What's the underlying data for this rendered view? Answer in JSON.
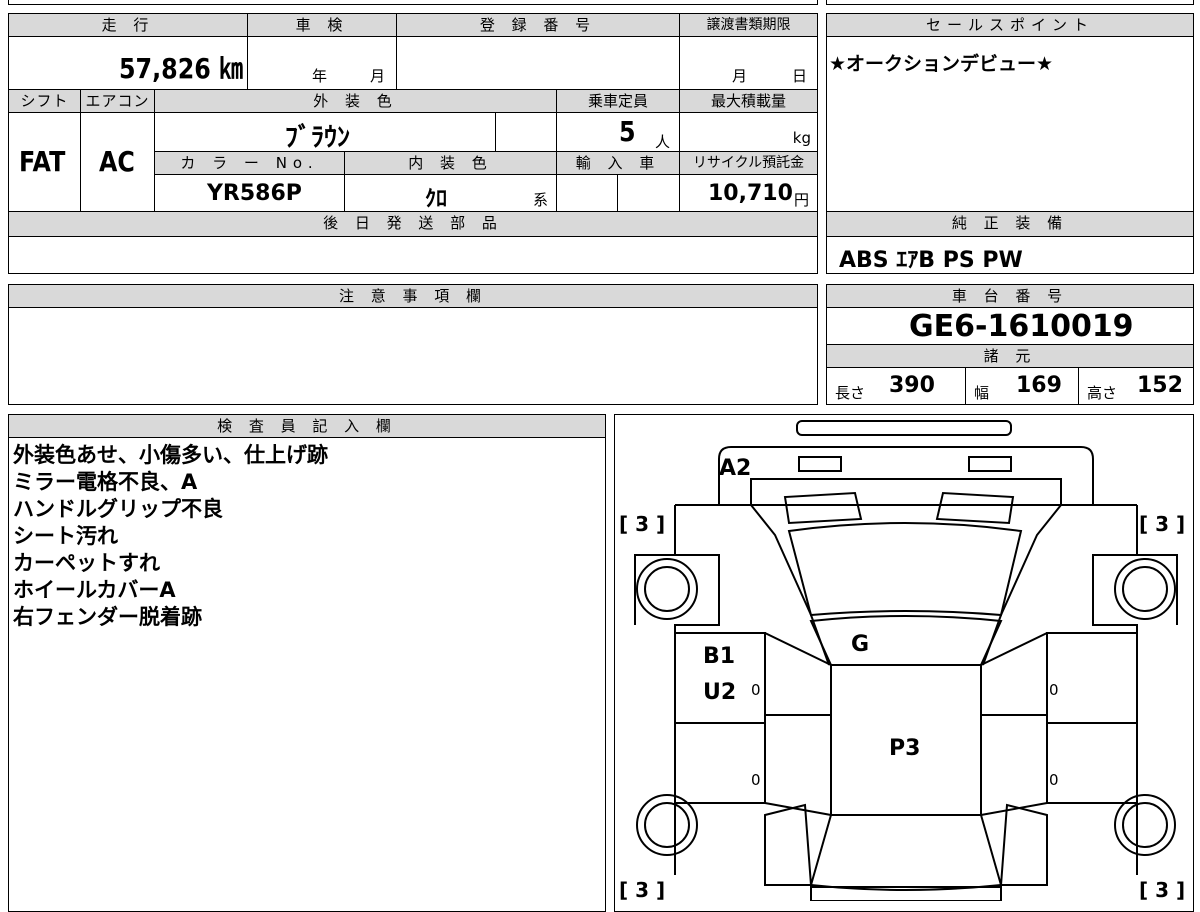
{
  "vehicle": {
    "mileage_label": "走 行",
    "mileage": "57,826 ㎞",
    "inspection_label": "車 検",
    "inspection_year_unit": "年",
    "inspection_month_unit": "月",
    "registration_label": "登 録 番 号",
    "registration_value": "",
    "transfer_deadline_label": "譲渡書類期限",
    "transfer_month_unit": "月",
    "transfer_day_unit": "日",
    "shift_label": "シフト",
    "shift": "FAT",
    "aircon_label": "エアコン",
    "aircon": "AC",
    "exterior_color_label": "外 装 色",
    "exterior_color": "ﾌﾞﾗｳﾝ",
    "capacity_label": "乗車定員",
    "capacity": "5",
    "capacity_unit": "人",
    "max_load_label": "最大積載量",
    "max_load_unit": "kg",
    "color_no_label": "カ ラ ー No.",
    "color_no": "YR586P",
    "interior_color_label": "内 装 色",
    "interior_color": "ｸﾛ",
    "interior_suffix": "系",
    "import_label": "輸 入 車",
    "recycle_label": "リサイクル預託金",
    "recycle_fee": "10,710",
    "recycle_unit": "円"
  },
  "sales_point": {
    "label": "セールスポイント",
    "text": "★オークションデビュー★"
  },
  "later_parts": {
    "label": "後 日 発 送 部 品"
  },
  "standard_equipment": {
    "label": "純 正 装 備",
    "items": "ABS ｴｱB PS PW"
  },
  "notes": {
    "label": "注 意 事 項 欄"
  },
  "chassis": {
    "label": "車 台 番 号",
    "number": "GE6-1610019"
  },
  "specs": {
    "label": "諸 元",
    "length_label": "長さ",
    "length": "390",
    "width_label": "幅",
    "width": "169",
    "height_label": "高さ",
    "height": "152"
  },
  "inspector": {
    "label": "検 査 員 記 入 欄",
    "lines": [
      "外装色あせ、小傷多い、仕上げ跡",
      "ミラー電格不良、A",
      "ハンドルグリップ不良",
      "シート汚れ",
      "カーペットすれ",
      "ホイールカバーA",
      "右フェンダー脱着跡"
    ]
  },
  "diagram": {
    "mark_a2": "A2",
    "mark_g": "G",
    "mark_b1": "B1",
    "mark_u2": "U2",
    "mark_p3": "P3",
    "tire_tl": "[ 3 ]",
    "tire_tr": "[ 3 ]",
    "tire_bl": "[ 3 ]",
    "tire_br": "[ 3 ]",
    "zero_1": "0",
    "zero_2": "0",
    "zero_3": "0",
    "zero_4": "0"
  }
}
